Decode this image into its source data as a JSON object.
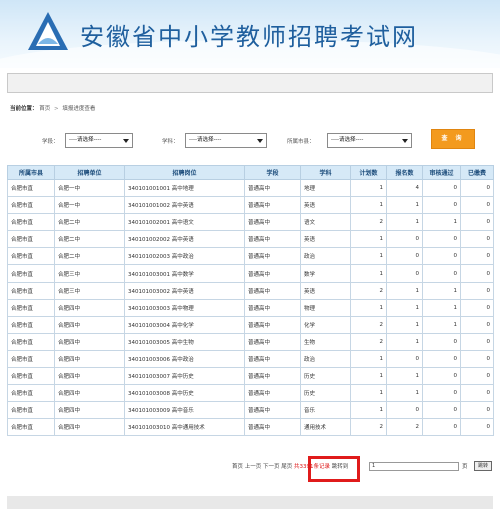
{
  "header": {
    "title": "安徽省中小学教师招聘考试网",
    "logo_icon": "triangle-mountain-logo",
    "brand_color": "#1f5f9e"
  },
  "breadcrumb": {
    "label": "当前位置：",
    "home": "首页",
    "separator": ">",
    "current": "填报进度查看"
  },
  "filters": {
    "xueduan": {
      "label": "学段：",
      "value": "----请选择----"
    },
    "xueke": {
      "label": "学科：",
      "value": "----请选择----"
    },
    "city": {
      "label": "所属市县：",
      "value": "----请选择----"
    },
    "query_label": "查  询",
    "query_color": "#f39a1e"
  },
  "table": {
    "headers": [
      "所属市县",
      "招聘单位",
      "招聘岗位",
      "学段",
      "学科",
      "计划数",
      "报名数",
      "审核通过",
      "已缴费"
    ],
    "rows": [
      [
        "合肥市直",
        "合肥一中",
        "340101001001 高中地理",
        "普通高中",
        "地理",
        "1",
        "4",
        "0",
        "0"
      ],
      [
        "合肥市直",
        "合肥一中",
        "340101001002 高中英语",
        "普通高中",
        "英语",
        "1",
        "1",
        "0",
        "0"
      ],
      [
        "合肥市直",
        "合肥二中",
        "340101002001 高中语文",
        "普通高中",
        "语文",
        "2",
        "1",
        "1",
        "0"
      ],
      [
        "合肥市直",
        "合肥二中",
        "340101002002 高中英语",
        "普通高中",
        "英语",
        "1",
        "0",
        "0",
        "0"
      ],
      [
        "合肥市直",
        "合肥二中",
        "340101002003 高中政治",
        "普通高中",
        "政治",
        "1",
        "0",
        "0",
        "0"
      ],
      [
        "合肥市直",
        "合肥三中",
        "340101003001 高中数学",
        "普通高中",
        "数学",
        "1",
        "0",
        "0",
        "0"
      ],
      [
        "合肥市直",
        "合肥三中",
        "340101003002 高中英语",
        "普通高中",
        "英语",
        "2",
        "1",
        "1",
        "0"
      ],
      [
        "合肥市直",
        "合肥四中",
        "340101003003 高中物理",
        "普通高中",
        "物理",
        "1",
        "1",
        "1",
        "0"
      ],
      [
        "合肥市直",
        "合肥四中",
        "340101003004 高中化学",
        "普通高中",
        "化学",
        "2",
        "1",
        "1",
        "0"
      ],
      [
        "合肥市直",
        "合肥四中",
        "340101003005 高中生物",
        "普通高中",
        "生物",
        "2",
        "1",
        "0",
        "0"
      ],
      [
        "合肥市直",
        "合肥四中",
        "340101003006 高中政治",
        "普通高中",
        "政治",
        "1",
        "0",
        "0",
        "0"
      ],
      [
        "合肥市直",
        "合肥四中",
        "340101003007 高中历史",
        "普通高中",
        "历史",
        "1",
        "1",
        "0",
        "0"
      ],
      [
        "合肥市直",
        "合肥四中",
        "340101003008 高中历史",
        "普通高中",
        "历史",
        "1",
        "1",
        "0",
        "0"
      ],
      [
        "合肥市直",
        "合肥四中",
        "340101003009 高中音乐",
        "普通高中",
        "音乐",
        "1",
        "0",
        "0",
        "0"
      ],
      [
        "合肥市直",
        "合肥四中",
        "340101003010 高中通用技术",
        "普通高中",
        "通用技术",
        "2",
        "2",
        "0",
        "0"
      ]
    ]
  },
  "pager": {
    "nav_text": "首页 上一页 下一页 尾页",
    "total_prefix": "共",
    "total_count": "3391",
    "total_suffix": "条记录",
    "jump_label": "跳转到",
    "jump_value": "1",
    "page_unit": "页",
    "jump_button": "跳转",
    "highlight_color": "#e01b1b"
  }
}
